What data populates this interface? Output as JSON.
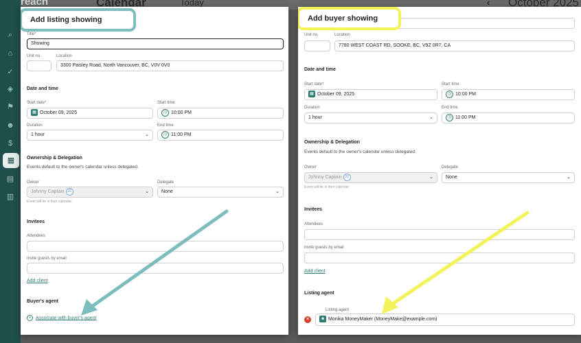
{
  "background": {
    "logo": "reach",
    "page_title": "Calendar",
    "today_button": "Today",
    "prev_icon": "chevron-left-icon",
    "month_label": "October 2025"
  },
  "listing_showing": {
    "title": "Add listing showing",
    "title_field": {
      "label": "Title*",
      "value": "Showing"
    },
    "unit_no": {
      "label": "Unit no.",
      "value": ""
    },
    "location": {
      "label": "Location",
      "value": "3300 Paisley Road, North Vancouver, BC, V0V 0V0"
    },
    "date_time_heading": "Date and time",
    "start_date": {
      "label": "Start date*",
      "value": "October 09, 2025"
    },
    "start_time": {
      "label": "Start time",
      "value": "10:00 PM"
    },
    "duration": {
      "label": "Duration",
      "value": "1 hour"
    },
    "end_time": {
      "label": "End time",
      "value": "11:00 PM"
    },
    "ownership_heading": "Ownership & Delegation",
    "ownership_note": "Events default to the owner's calendar unless delegated.",
    "owner": {
      "label": "Owner",
      "value": "Johnny Captain",
      "initials": "JC",
      "hint": "Event will be in their calendar."
    },
    "delegate": {
      "label": "Delegate",
      "value": "None"
    },
    "invitees_heading": "Invitees",
    "attendees": {
      "label": "Attendees",
      "value": ""
    },
    "invite_email": {
      "label": "Invite guests by email",
      "value": ""
    },
    "add_client": "Add client",
    "buyers_agent_heading": "Buyer's agent",
    "associate_link": "Associate with buyer's agent"
  },
  "buyer_showing": {
    "title": "Add buyer showing",
    "unit_no": {
      "label": "Unit no.",
      "value": ""
    },
    "location": {
      "label": "Location",
      "value": "7780 WEST COAST RD, SOOKE, BC, V9Z 0R7, CA"
    },
    "date_time_heading": "Date and time",
    "start_date": {
      "label": "Start date*",
      "value": "October 09, 2025"
    },
    "start_time": {
      "label": "Start time",
      "value": "10:00 PM"
    },
    "duration": {
      "label": "Duration",
      "value": "1 hour"
    },
    "end_time": {
      "label": "End time",
      "value": "11:00 PM"
    },
    "ownership_heading": "Ownership & Delegation",
    "ownership_note": "Events default to the owner's calendar unless delegated.",
    "owner": {
      "label": "Owner",
      "value": "Johnny Captain",
      "initials": "JC",
      "hint": "Event will be in their calendar."
    },
    "delegate": {
      "label": "Delegate",
      "value": "None"
    },
    "invitees_heading": "Invitees",
    "attendees": {
      "label": "Attendees",
      "value": ""
    },
    "invite_email": {
      "label": "Invite guests by email",
      "value": ""
    },
    "add_client": "Add client",
    "listing_agent_heading": "Listing agent",
    "listing_agent": {
      "label": "Listing agent",
      "value": "Monika MoneyMaker (MoneyMake@example.com)"
    }
  },
  "colors": {
    "accent": "#2e7d74",
    "teal_highlight": "#7dbdbb",
    "yellow_highlight": "#f2f25a",
    "remove": "#d83a2e"
  }
}
